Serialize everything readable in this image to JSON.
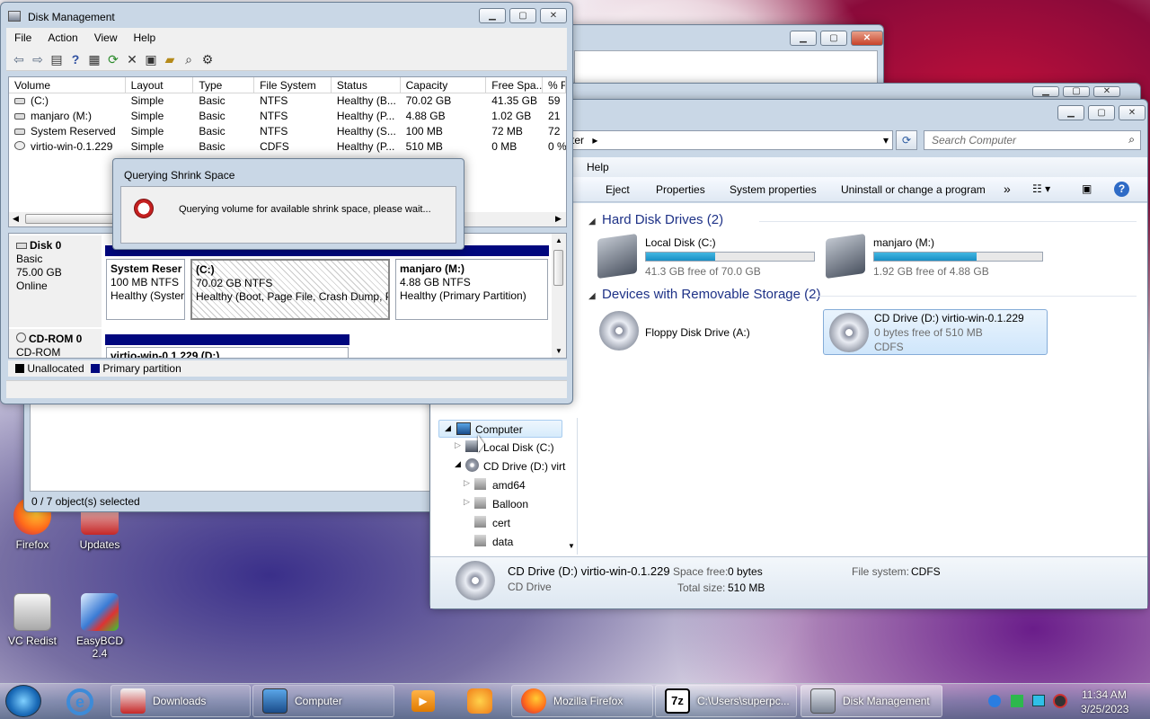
{
  "desktop": {
    "icons": [
      {
        "label": "Firefox"
      },
      {
        "label": "Updates"
      },
      {
        "label": "VC Redist"
      },
      {
        "label": "EasyBCD 2.4"
      }
    ]
  },
  "disk_mgmt": {
    "title": "Disk Management",
    "menu": [
      "File",
      "Action",
      "View",
      "Help"
    ],
    "columns": [
      "Volume",
      "Layout",
      "Type",
      "File System",
      "Status",
      "Capacity",
      "Free Spa...",
      "% F"
    ],
    "rows": [
      [
        "(C:)",
        "Simple",
        "Basic",
        "NTFS",
        "Healthy (B...",
        "70.02 GB",
        "41.35 GB",
        "59"
      ],
      [
        "manjaro (M:)",
        "Simple",
        "Basic",
        "NTFS",
        "Healthy (P...",
        "4.88 GB",
        "1.02 GB",
        "21"
      ],
      [
        "System Reserved",
        "Simple",
        "Basic",
        "NTFS",
        "Healthy (S...",
        "100 MB",
        "72 MB",
        "72"
      ],
      [
        "virtio-win-0.1.229",
        "Simple",
        "Basic",
        "CDFS",
        "Healthy (P...",
        "510 MB",
        "0 MB",
        "0 %"
      ]
    ],
    "disk0": {
      "name": "Disk 0",
      "type": "Basic",
      "size": "75.00 GB",
      "state": "Online"
    },
    "partitions": [
      {
        "name": "System Reser",
        "size": "100 MB NTFS",
        "status": "Healthy (Syster"
      },
      {
        "name": "(C:)",
        "size": "70.02 GB NTFS",
        "status": "Healthy (Boot, Page File, Crash Dump, P"
      },
      {
        "name": "manjaro  (M:)",
        "size": "4.88 GB NTFS",
        "status": "Healthy (Primary Partition)"
      }
    ],
    "cdrom": {
      "name": "CD-ROM 0",
      "type": "CD-ROM",
      "partition": "virtio-win-0.1.229  (D:)"
    },
    "legend": {
      "unallocated": "Unallocated",
      "primary": "Primary partition"
    },
    "colors": {
      "primary": "#00077e",
      "unallocated": "#000000"
    }
  },
  "dialog": {
    "title": "Querying Shrink Space",
    "message": "Querying volume for available shrink space, please wait..."
  },
  "explorer": {
    "address_tail": "ter",
    "search_placeholder": "Search Computer",
    "menu_help": "Help",
    "commands": [
      "Eject",
      "Properties",
      "System properties",
      "Uninstall or change a program",
      "»"
    ],
    "hdd_header": "Hard Disk Drives (2)",
    "drives": [
      {
        "name": "Local Disk (C:)",
        "free": "41.3 GB free of 70.0 GB",
        "used_fraction": 0.41
      },
      {
        "name": "manjaro (M:)",
        "free": "1.92 GB free of 4.88 GB",
        "used_fraction": 0.61
      }
    ],
    "removable_header": "Devices with Removable Storage (2)",
    "floppy": "Floppy Disk Drive (A:)",
    "cd": {
      "name": "CD Drive (D:) virtio-win-0.1.229",
      "free": "0 bytes free of 510 MB",
      "fs": "CDFS"
    },
    "tree": [
      {
        "label": "Computer",
        "level": 0
      },
      {
        "label": "Local Disk (C:)",
        "level": 1
      },
      {
        "label": "CD Drive (D:) virt",
        "level": 1
      },
      {
        "label": "amd64",
        "level": 2
      },
      {
        "label": "Balloon",
        "level": 2
      },
      {
        "label": "cert",
        "level": 2
      },
      {
        "label": "data",
        "level": 2
      }
    ],
    "details": {
      "name": "CD Drive (D:) virtio-win-0.1.229",
      "kind": "CD Drive",
      "space_free_label": "Space free:",
      "space_free": "0 bytes",
      "total_label": "Total size:",
      "total": "510 MB",
      "fs_label": "File system:",
      "fs": "CDFS"
    }
  },
  "back_window": {
    "status": "0 / 7 object(s) selected"
  },
  "taskbar": {
    "buttons": [
      "Downloads",
      "Computer",
      "Mozilla Firefox",
      "C:\\Users\\superpc...",
      "Disk Management"
    ],
    "time": "11:34 AM",
    "date": "3/25/2023"
  }
}
